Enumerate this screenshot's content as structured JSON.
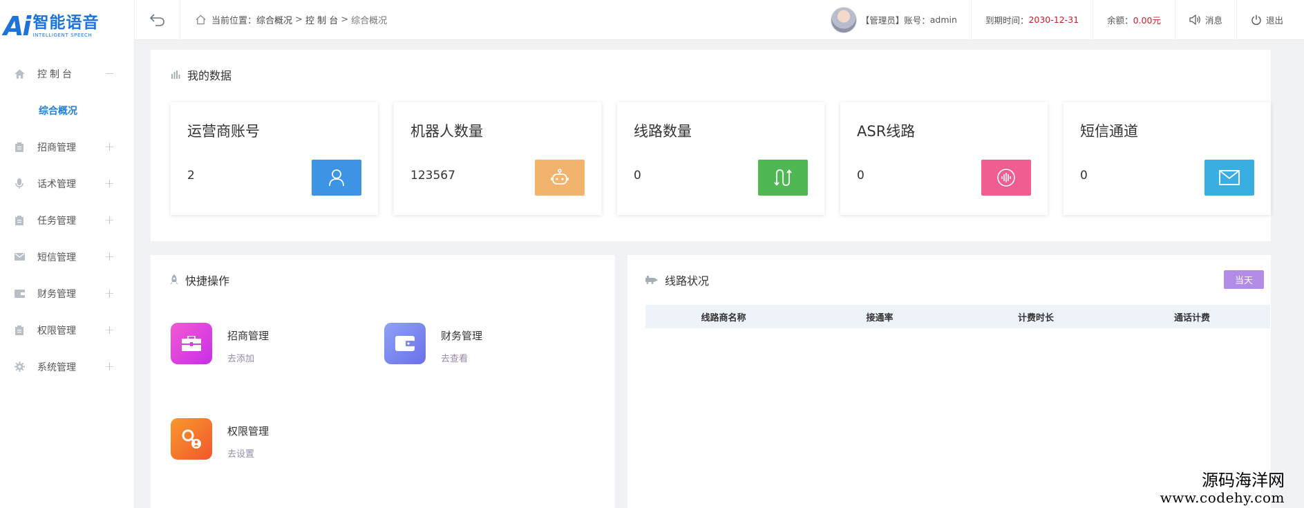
{
  "logo": {
    "mark": "Ai",
    "cn": "智能语音",
    "en": "INTELLIGENT SPEECH"
  },
  "sidebar": {
    "items": [
      {
        "label": "控制台",
        "toggle": "−",
        "icon": "home-icon"
      },
      {
        "label": "招商管理",
        "toggle": "+",
        "icon": "clipboard-icon"
      },
      {
        "label": "话术管理",
        "toggle": "+",
        "icon": "microphone-icon"
      },
      {
        "label": "任务管理",
        "toggle": "+",
        "icon": "clipboard-icon"
      },
      {
        "label": "短信管理",
        "toggle": "+",
        "icon": "envelope-icon"
      },
      {
        "label": "财务管理",
        "toggle": "+",
        "icon": "wallet-icon"
      },
      {
        "label": "权限管理",
        "toggle": "+",
        "icon": "clipboard-icon"
      },
      {
        "label": "系统管理",
        "toggle": "+",
        "icon": "gear-icon"
      }
    ],
    "active_sub": "综合概况"
  },
  "header": {
    "breadcrumb_prefix": "当前位置：",
    "crumbs": [
      "综合概况",
      "控 制 台",
      "综合概况"
    ],
    "sep": ">",
    "role": "【管理员】",
    "account_label": "账号：",
    "account": "admin",
    "expire_label": "到期时间：",
    "expire": "2030-12-31",
    "balance_label": "余额：",
    "balance": "0.00元",
    "message": "消息",
    "logout": "退出"
  },
  "my_data": {
    "title": "我的数据",
    "cards": [
      {
        "title": "运营商账号",
        "value": "2",
        "color": "#3e94e4",
        "icon": "user-icon"
      },
      {
        "title": "机器人数量",
        "value": "123567",
        "color": "#f2b46c",
        "icon": "robot-icon"
      },
      {
        "title": "线路数量",
        "value": "0",
        "color": "#4fb853",
        "icon": "route-icon"
      },
      {
        "title": "ASR线路",
        "value": "0",
        "color": "#f05d93",
        "icon": "voice-icon"
      },
      {
        "title": "短信通道",
        "value": "0",
        "color": "#3aaee0",
        "icon": "mail-icon"
      }
    ]
  },
  "quick": {
    "title": "快捷操作",
    "items": [
      {
        "name": "招商管理",
        "sub": "去添加",
        "icon": "briefcase-icon"
      },
      {
        "name": "财务管理",
        "sub": "去查看",
        "icon": "wallet-icon"
      },
      {
        "name": "权限管理",
        "sub": "去设置",
        "icon": "key-user-icon"
      }
    ]
  },
  "line_status": {
    "title": "线路状况",
    "today": "当天",
    "columns": [
      "线路商名称",
      "接通率",
      "计费时长",
      "通话计费"
    ]
  },
  "watermark": {
    "cn": "源码海洋网",
    "url": "www.codehy.com"
  }
}
